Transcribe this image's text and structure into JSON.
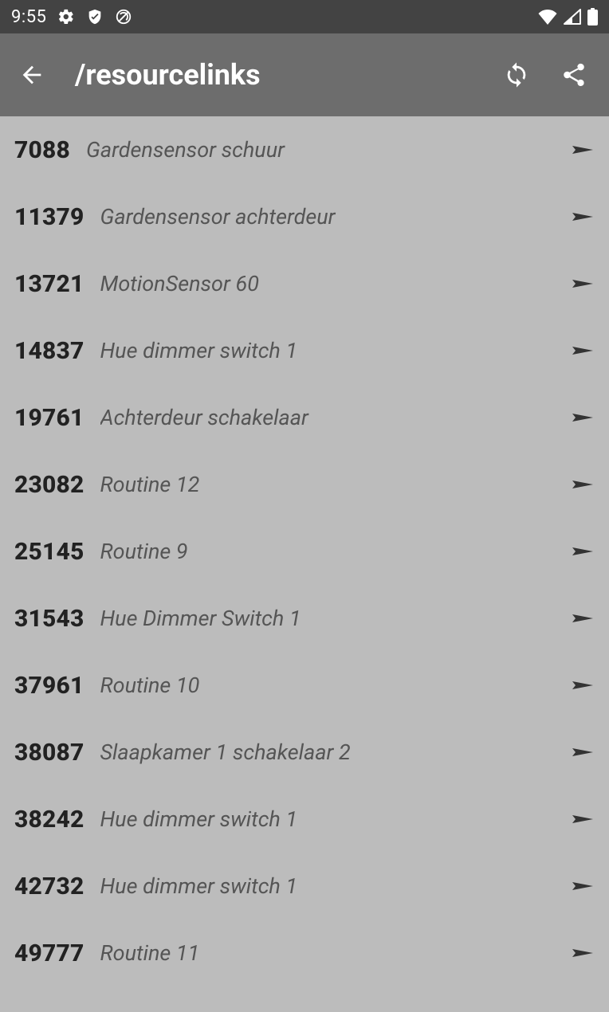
{
  "statusbar": {
    "clock": "9:55"
  },
  "appbar": {
    "title": "/resourcelinks"
  },
  "items": [
    {
      "id": "7088",
      "label": "Gardensensor schuur"
    },
    {
      "id": "11379",
      "label": "Gardensensor achterdeur"
    },
    {
      "id": "13721",
      "label": "MotionSensor 60"
    },
    {
      "id": "14837",
      "label": "Hue dimmer switch 1"
    },
    {
      "id": "19761",
      "label": "Achterdeur schakelaar"
    },
    {
      "id": "23082",
      "label": "Routine 12"
    },
    {
      "id": "25145",
      "label": "Routine 9"
    },
    {
      "id": "31543",
      "label": "Hue Dimmer Switch 1"
    },
    {
      "id": "37961",
      "label": "Routine 10"
    },
    {
      "id": "38087",
      "label": "Slaapkamer 1 schakelaar 2"
    },
    {
      "id": "38242",
      "label": "Hue dimmer switch 1"
    },
    {
      "id": "42732",
      "label": "Hue dimmer switch 1"
    },
    {
      "id": "49777",
      "label": "Routine 11"
    }
  ]
}
